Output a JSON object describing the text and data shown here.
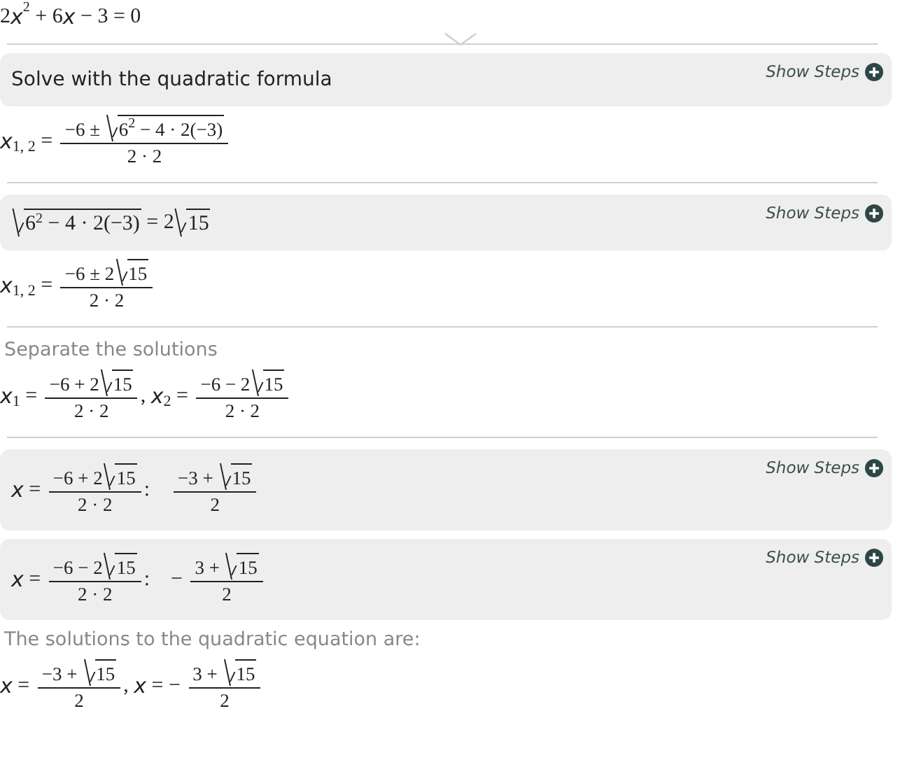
{
  "problem": [
    {
      "kind": "text",
      "text": "2"
    },
    {
      "kind": "var",
      "text": "x"
    },
    {
      "kind": "sup",
      "text": "2"
    },
    {
      "kind": "text",
      "text": " + 6"
    },
    {
      "kind": "var",
      "text": "x"
    },
    {
      "kind": "text",
      "text": " − 3 = 0"
    }
  ],
  "steps": [
    {
      "kind": "panel",
      "title": "Solve with the quadratic formula",
      "action": "Show Steps"
    },
    {
      "kind": "math",
      "math": [
        {
          "kind": "var",
          "text": "x"
        },
        {
          "kind": "sub",
          "text": "1, 2"
        },
        {
          "kind": "text",
          "text": " = "
        },
        {
          "kind": "frac",
          "num": [
            {
              "kind": "text",
              "text": "−6 ± "
            },
            {
              "kind": "sqrt",
              "body": [
                {
                  "kind": "text",
                  "text": "6"
                },
                {
                  "kind": "sup",
                  "text": "2"
                },
                {
                  "kind": "text",
                  "text": " − 4 · 2(−3)"
                }
              ]
            }
          ],
          "den": [
            {
              "kind": "text",
              "text": "2 · 2"
            }
          ]
        }
      ]
    },
    {
      "kind": "divider"
    },
    {
      "kind": "panel",
      "math": [
        {
          "kind": "sqrt",
          "body": [
            {
              "kind": "text",
              "text": "6"
            },
            {
              "kind": "sup",
              "text": "2"
            },
            {
              "kind": "text",
              "text": " − 4 · 2(−3)"
            }
          ]
        },
        {
          "kind": "text",
          "text": " = 2"
        },
        {
          "kind": "sqrt",
          "body": [
            {
              "kind": "text",
              "text": "15"
            }
          ]
        }
      ],
      "action": "Show Steps"
    },
    {
      "kind": "math",
      "math": [
        {
          "kind": "var",
          "text": "x"
        },
        {
          "kind": "sub",
          "text": "1, 2"
        },
        {
          "kind": "text",
          "text": " = "
        },
        {
          "kind": "frac",
          "num": [
            {
              "kind": "text",
              "text": "−6 ± 2"
            },
            {
              "kind": "sqrt",
              "body": [
                {
                  "kind": "text",
                  "text": "15"
                }
              ]
            }
          ],
          "den": [
            {
              "kind": "text",
              "text": "2 · 2"
            }
          ]
        }
      ]
    },
    {
      "kind": "divider"
    },
    {
      "kind": "note",
      "text": "Separate the solutions"
    },
    {
      "kind": "math",
      "math": [
        {
          "kind": "var",
          "text": "x"
        },
        {
          "kind": "sub",
          "text": "1"
        },
        {
          "kind": "text",
          "text": " = "
        },
        {
          "kind": "frac",
          "num": [
            {
              "kind": "text",
              "text": "−6 + 2"
            },
            {
              "kind": "sqrt",
              "body": [
                {
                  "kind": "text",
                  "text": "15"
                }
              ]
            }
          ],
          "den": [
            {
              "kind": "text",
              "text": "2 · 2"
            }
          ]
        },
        {
          "kind": "text",
          "text": ", "
        },
        {
          "kind": "var",
          "text": "x"
        },
        {
          "kind": "sub",
          "text": "2"
        },
        {
          "kind": "text",
          "text": " = "
        },
        {
          "kind": "frac",
          "num": [
            {
              "kind": "text",
              "text": "−6 − 2"
            },
            {
              "kind": "sqrt",
              "body": [
                {
                  "kind": "text",
                  "text": "15"
                }
              ]
            }
          ],
          "den": [
            {
              "kind": "text",
              "text": "2 · 2"
            }
          ]
        }
      ]
    },
    {
      "kind": "divider"
    },
    {
      "kind": "panel",
      "math": [
        {
          "kind": "var",
          "text": "x"
        },
        {
          "kind": "text",
          "text": " = "
        },
        {
          "kind": "frac",
          "num": [
            {
              "kind": "text",
              "text": "−6 + 2"
            },
            {
              "kind": "sqrt",
              "body": [
                {
                  "kind": "text",
                  "text": "15"
                }
              ]
            }
          ],
          "den": [
            {
              "kind": "text",
              "text": "2 · 2"
            }
          ]
        },
        {
          "kind": "text",
          "text": ":    "
        },
        {
          "kind": "frac",
          "num": [
            {
              "kind": "text",
              "text": "−3 + "
            },
            {
              "kind": "sqrt",
              "body": [
                {
                  "kind": "text",
                  "text": "15"
                }
              ]
            }
          ],
          "den": [
            {
              "kind": "text",
              "text": "2"
            }
          ]
        }
      ],
      "action": "Show Steps"
    },
    {
      "kind": "panel",
      "math": [
        {
          "kind": "var",
          "text": "x"
        },
        {
          "kind": "text",
          "text": " = "
        },
        {
          "kind": "frac",
          "num": [
            {
              "kind": "text",
              "text": "−6 − 2"
            },
            {
              "kind": "sqrt",
              "body": [
                {
                  "kind": "text",
                  "text": "15"
                }
              ]
            }
          ],
          "den": [
            {
              "kind": "text",
              "text": "2 · 2"
            }
          ]
        },
        {
          "kind": "text",
          "text": ":    − "
        },
        {
          "kind": "frac",
          "num": [
            {
              "kind": "text",
              "text": "3 + "
            },
            {
              "kind": "sqrt",
              "body": [
                {
                  "kind": "text",
                  "text": "15"
                }
              ]
            }
          ],
          "den": [
            {
              "kind": "text",
              "text": "2"
            }
          ]
        }
      ],
      "action": "Show Steps"
    },
    {
      "kind": "note",
      "text": "The solutions to the quadratic equation are:"
    },
    {
      "kind": "math",
      "math": [
        {
          "kind": "var",
          "text": "x"
        },
        {
          "kind": "text",
          "text": " = "
        },
        {
          "kind": "frac",
          "num": [
            {
              "kind": "text",
              "text": "−3 + "
            },
            {
              "kind": "sqrt",
              "body": [
                {
                  "kind": "text",
                  "text": "15"
                }
              ]
            }
          ],
          "den": [
            {
              "kind": "text",
              "text": "2"
            }
          ]
        },
        {
          "kind": "text",
          "text": ", "
        },
        {
          "kind": "var",
          "text": "x"
        },
        {
          "kind": "text",
          "text": " = − "
        },
        {
          "kind": "frac",
          "num": [
            {
              "kind": "text",
              "text": "3 + "
            },
            {
              "kind": "sqrt",
              "body": [
                {
                  "kind": "text",
                  "text": "15"
                }
              ]
            }
          ],
          "den": [
            {
              "kind": "text",
              "text": "2"
            }
          ]
        }
      ]
    }
  ]
}
